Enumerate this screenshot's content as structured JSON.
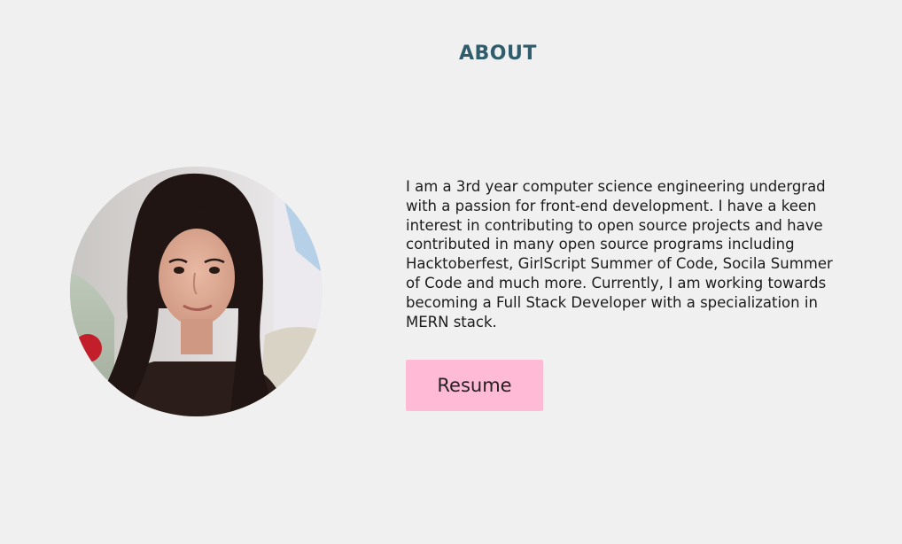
{
  "about": {
    "title": "ABOUT",
    "bio": "I am a 3rd year computer science engineering undergrad with a passion for front-end development. I have a keen interest in contributing to open source projects and have contributed in many open source programs including Hacktoberfest, GirlScript Summer of Code, Socila Summer of Code and much more. Currently, I am working towards becoming a Full Stack Developer with a specialization in MERN stack.",
    "resume_label": "Resume"
  },
  "colors": {
    "background": "#f0f0f0",
    "title": "#2f5d6b",
    "button": "#ffbad6",
    "text": "#1c1c1c"
  }
}
